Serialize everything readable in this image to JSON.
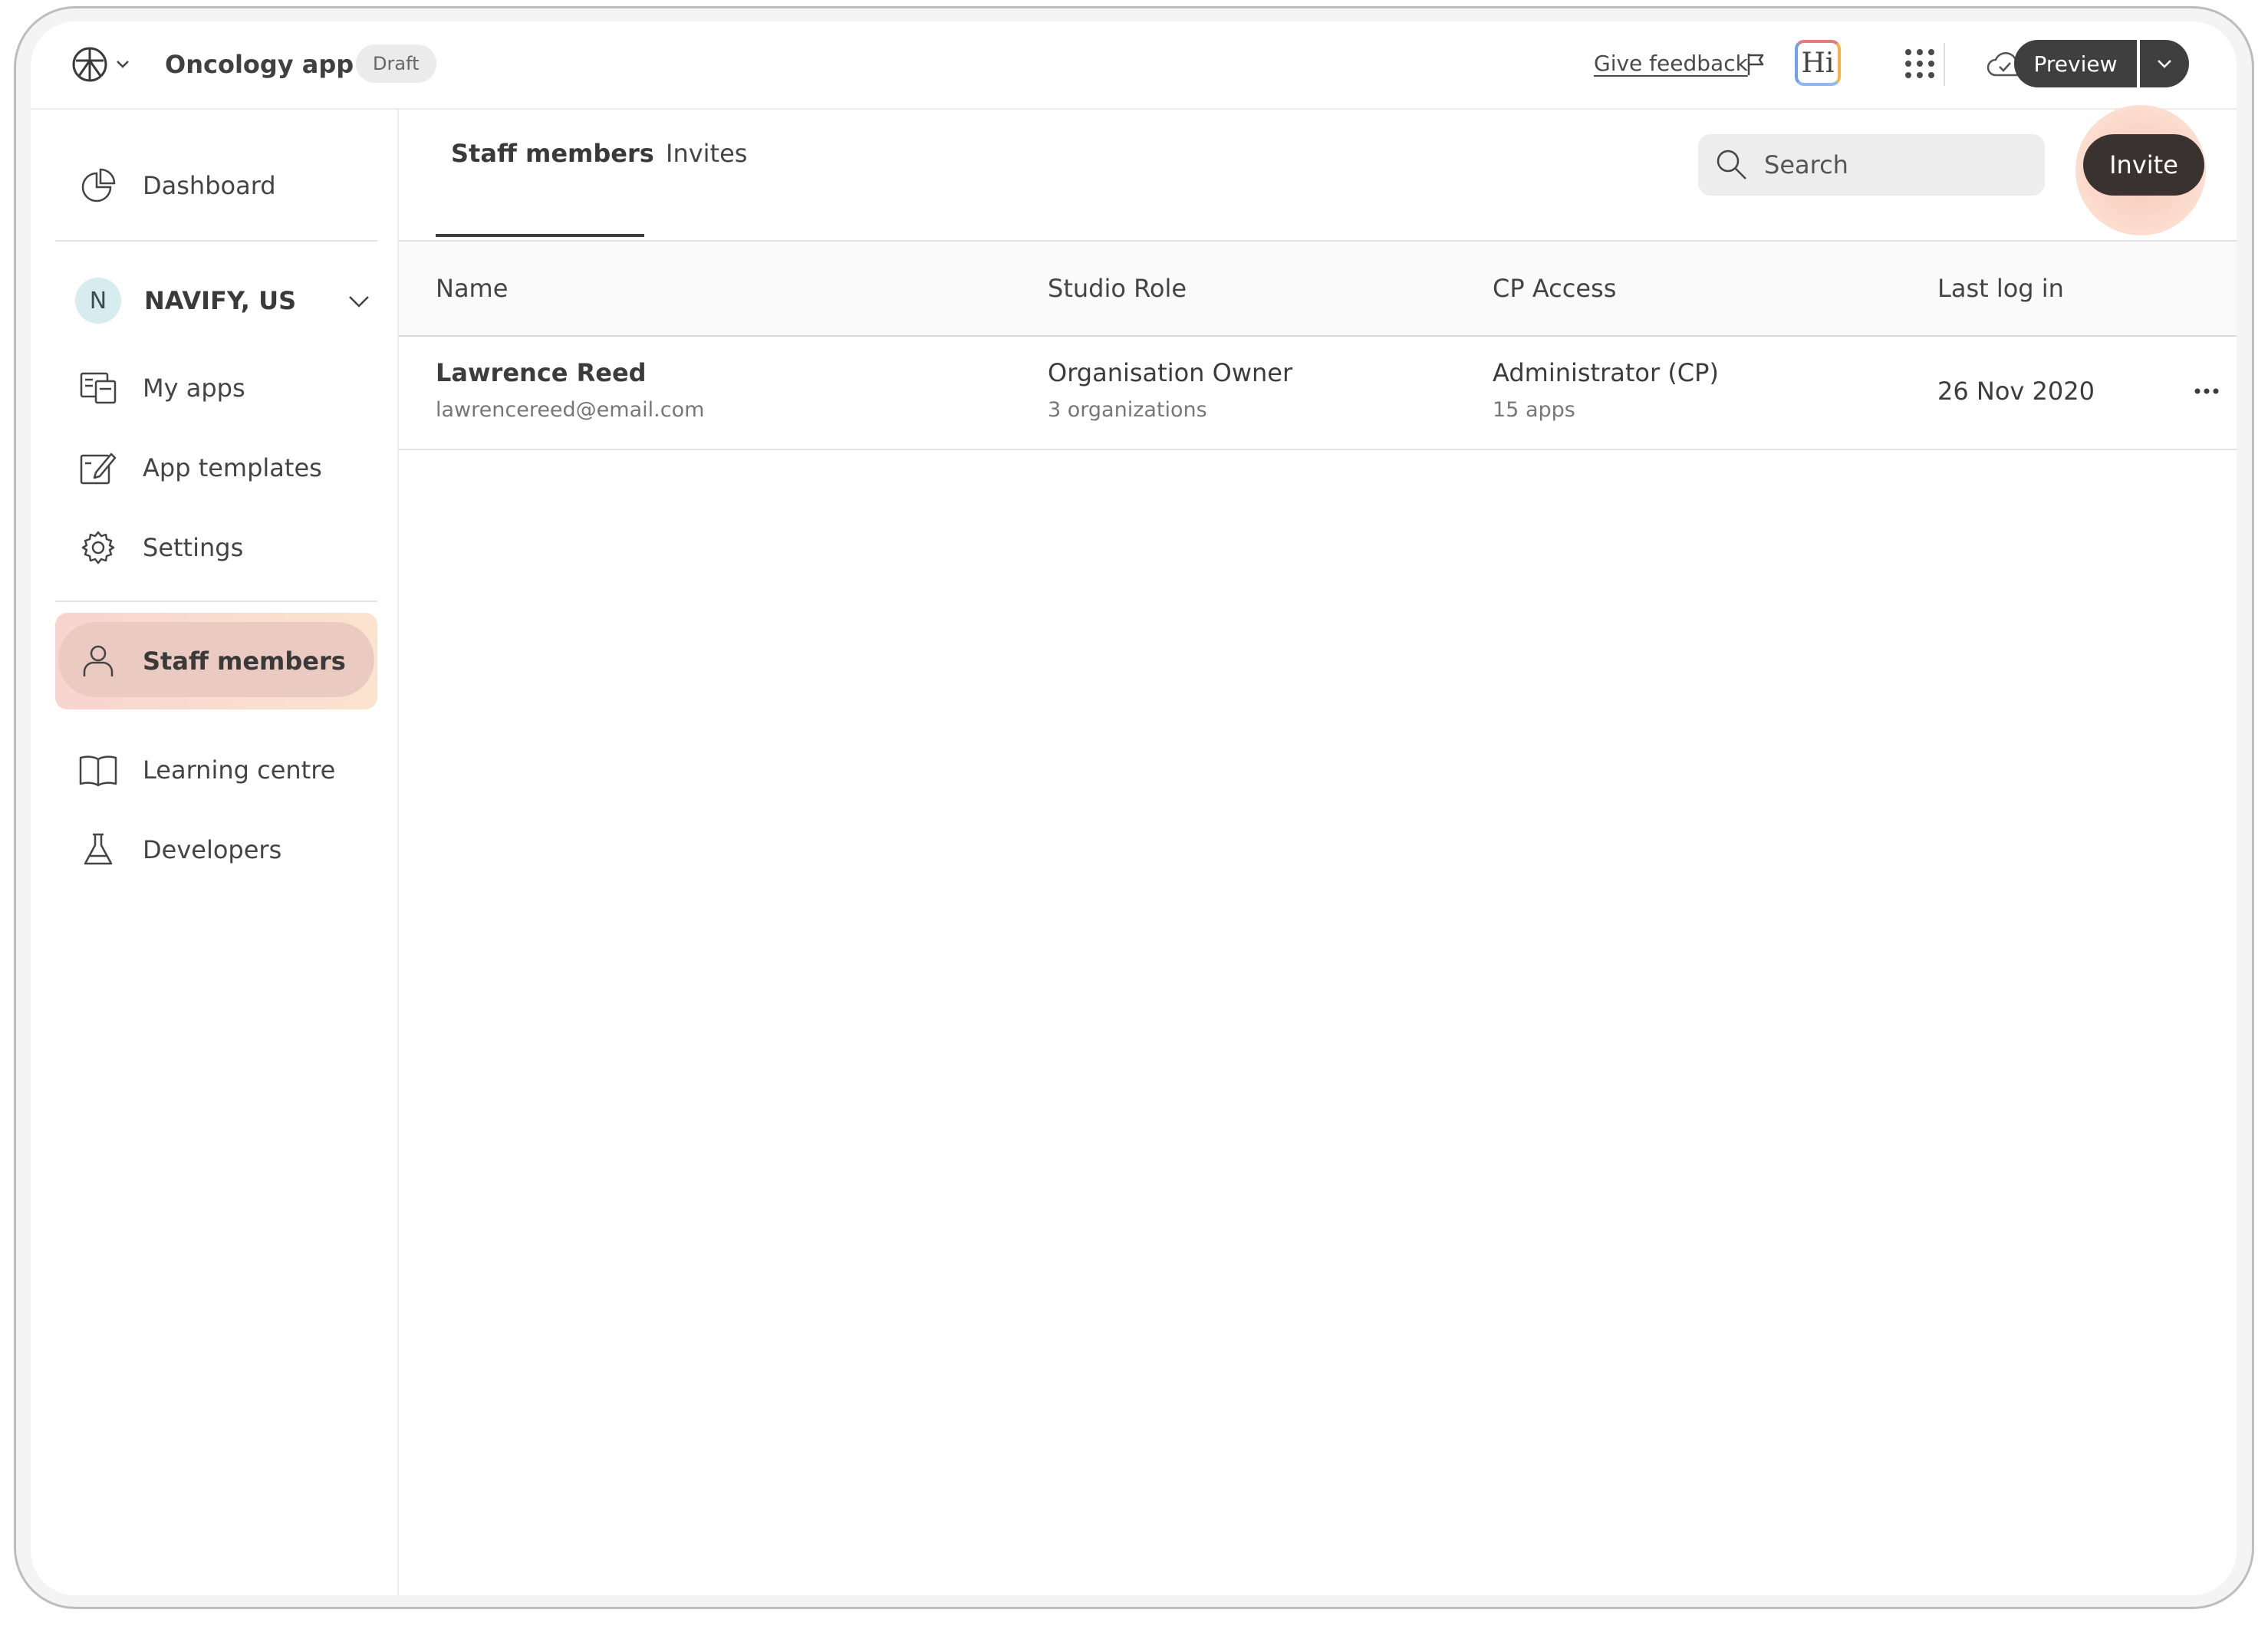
{
  "header": {
    "app_title": "Oncology app",
    "status_badge": "Draft",
    "feedback_link": "Give feedback",
    "hi_label": "Hi",
    "preview_label": "Preview"
  },
  "sidebar": {
    "dashboard": "Dashboard",
    "org": {
      "initial": "N",
      "name": "NAVIFY, US"
    },
    "items": [
      {
        "label": "My apps",
        "icon": "apps-icon"
      },
      {
        "label": "App templates",
        "icon": "template-icon"
      },
      {
        "label": "Settings",
        "icon": "gear-icon"
      },
      {
        "label": "Staff members",
        "icon": "person-icon",
        "active": true
      },
      {
        "label": "Learning centre",
        "icon": "book-icon"
      },
      {
        "label": "Developers",
        "icon": "flask-icon"
      }
    ]
  },
  "main": {
    "tabs": [
      {
        "label": "Staff members",
        "active": true
      },
      {
        "label": "Invites",
        "active": false
      }
    ],
    "search_placeholder": "Search",
    "invite_label": "Invite",
    "table": {
      "columns": [
        "Name",
        "Studio Role",
        "CP Access",
        "Last log in"
      ],
      "rows": [
        {
          "name": "Lawrence Reed",
          "email": "lawrencereed@email.com",
          "role": "Organisation Owner",
          "role_sub": "3 organizations",
          "access": "Administrator (CP)",
          "access_sub": "15 apps",
          "last_login": "26 Nov 2020"
        }
      ]
    }
  },
  "colors": {
    "accent_dark": "#3f3f3f",
    "active_nav_bg": "#ebcac2",
    "invite_glow": "#f9c7b9",
    "org_badge_bg": "#d6ecef"
  }
}
